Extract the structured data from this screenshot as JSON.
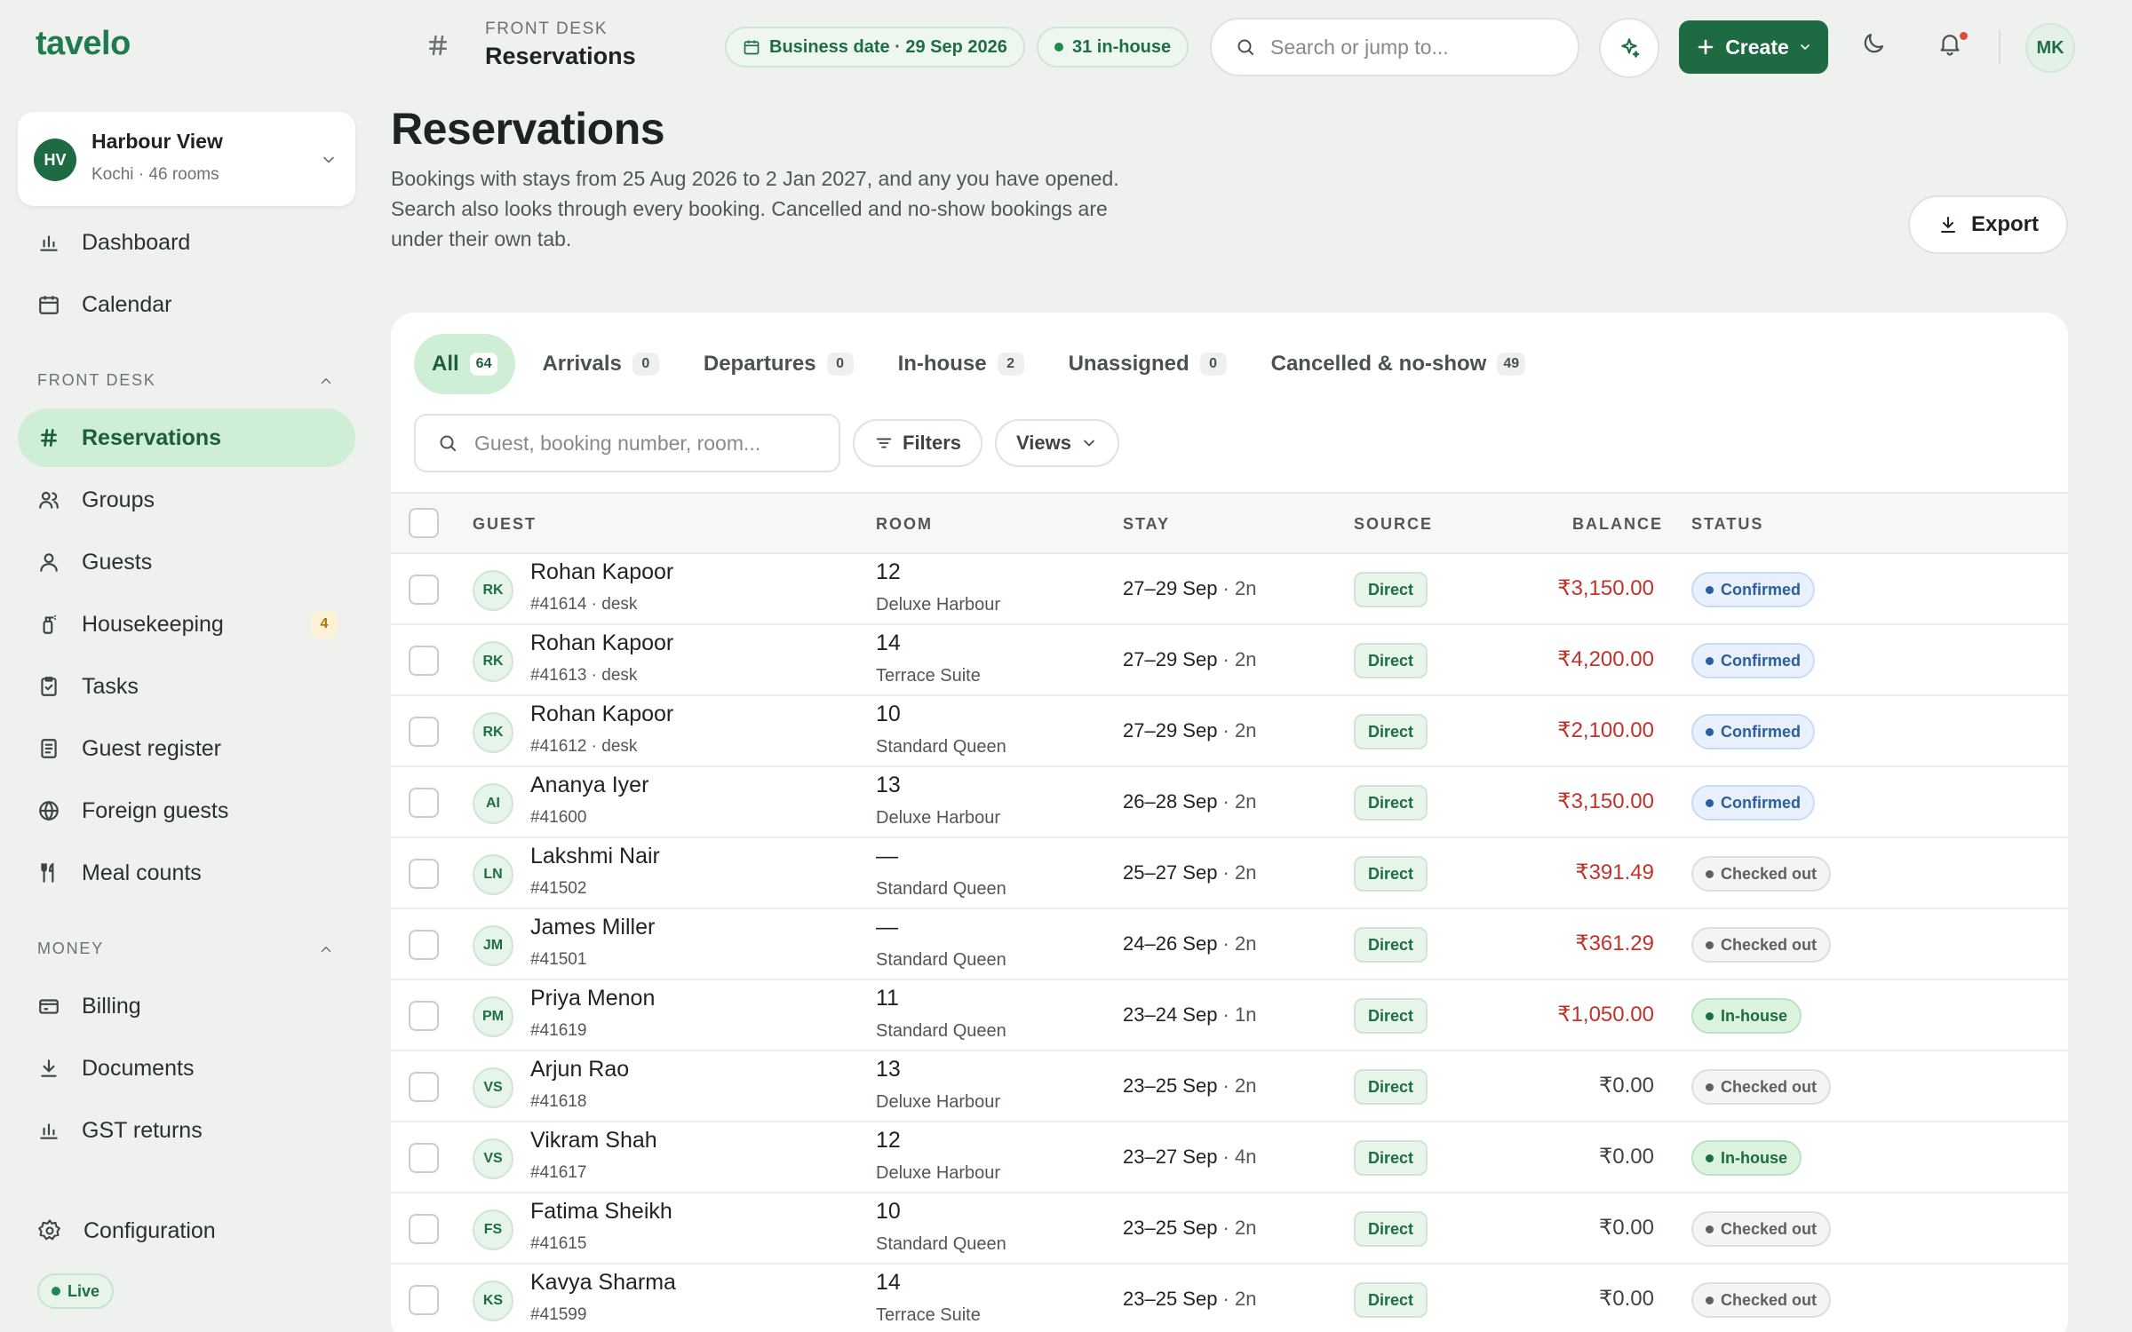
{
  "app": {
    "logo": "tavelo"
  },
  "header": {
    "crumb_section": "FRONT DESK",
    "crumb_title": "Reservations",
    "business_date": "Business date · 29 Sep 2026",
    "in_house": "31 in-house",
    "search_placeholder": "Search or jump to...",
    "create_label": "Create",
    "user_initials": "MK"
  },
  "property": {
    "initials": "HV",
    "name": "Harbour View",
    "sub": "Kochi · 46 rooms"
  },
  "sidebar": {
    "top_items": [
      {
        "label": "Dashboard",
        "icon": "bar-chart-icon"
      },
      {
        "label": "Calendar",
        "icon": "calendar-icon"
      }
    ],
    "front_desk_label": "FRONT DESK",
    "front_desk_items": [
      {
        "label": "Reservations",
        "icon": "hash-icon"
      },
      {
        "label": "Groups",
        "icon": "users-icon"
      },
      {
        "label": "Guests",
        "icon": "user-icon"
      },
      {
        "label": "Housekeeping",
        "icon": "spray-icon",
        "badge": "4"
      },
      {
        "label": "Tasks",
        "icon": "clipboard-check-icon"
      },
      {
        "label": "Guest register",
        "icon": "register-icon"
      },
      {
        "label": "Foreign guests",
        "icon": "globe-icon"
      },
      {
        "label": "Meal counts",
        "icon": "utensils-icon"
      }
    ],
    "money_label": "MONEY",
    "money_items": [
      {
        "label": "Billing",
        "icon": "credit-card-icon"
      },
      {
        "label": "Documents",
        "icon": "download-icon"
      },
      {
        "label": "GST returns",
        "icon": "bar-chart-icon"
      }
    ],
    "config_label": "Configuration",
    "live_label": "Live"
  },
  "main": {
    "title": "Reservations",
    "description": "Bookings with stays from 25 Aug 2026 to 2 Jan 2027, and any you have opened. Search also looks through every booking. Cancelled and no-show bookings are under their own tab.",
    "export_label": "Export",
    "tabs": [
      {
        "label": "All",
        "count": "64"
      },
      {
        "label": "Arrivals",
        "count": "0"
      },
      {
        "label": "Departures",
        "count": "0"
      },
      {
        "label": "In-house",
        "count": "2"
      },
      {
        "label": "Unassigned",
        "count": "0"
      },
      {
        "label": "Cancelled & no-show",
        "count": "49"
      }
    ],
    "search_placeholder": "Guest, booking number, room...",
    "filters_label": "Filters",
    "views_label": "Views",
    "columns": [
      "GUEST",
      "ROOM",
      "STAY",
      "SOURCE",
      "BALANCE",
      "STATUS"
    ],
    "rows": [
      {
        "initials": "RK",
        "name": "Rohan Kapoor",
        "ref": "#41614 · desk",
        "room": "12",
        "room_type": "Deluxe Harbour",
        "stay": "27–29 Sep",
        "nights": "2n",
        "source": "Direct",
        "balance": "₹3,150.00",
        "balance_due": true,
        "status": "Confirmed",
        "status_kind": "confirmed"
      },
      {
        "initials": "RK",
        "name": "Rohan Kapoor",
        "ref": "#41613 · desk",
        "room": "14",
        "room_type": "Terrace Suite",
        "stay": "27–29 Sep",
        "nights": "2n",
        "source": "Direct",
        "balance": "₹4,200.00",
        "balance_due": true,
        "status": "Confirmed",
        "status_kind": "confirmed"
      },
      {
        "initials": "RK",
        "name": "Rohan Kapoor",
        "ref": "#41612 · desk",
        "room": "10",
        "room_type": "Standard Queen",
        "stay": "27–29 Sep",
        "nights": "2n",
        "source": "Direct",
        "balance": "₹2,100.00",
        "balance_due": true,
        "status": "Confirmed",
        "status_kind": "confirmed"
      },
      {
        "initials": "AI",
        "name": "Ananya Iyer",
        "ref": "#41600",
        "room": "13",
        "room_type": "Deluxe Harbour",
        "stay": "26–28 Sep",
        "nights": "2n",
        "source": "Direct",
        "balance": "₹3,150.00",
        "balance_due": true,
        "status": "Confirmed",
        "status_kind": "confirmed"
      },
      {
        "initials": "LN",
        "name": "Lakshmi Nair",
        "ref": "#41502",
        "room": "—",
        "room_type": "Standard Queen",
        "stay": "25–27 Sep",
        "nights": "2n",
        "source": "Direct",
        "balance": "₹391.49",
        "balance_due": true,
        "status": "Checked out",
        "status_kind": "checkedout"
      },
      {
        "initials": "JM",
        "name": "James Miller",
        "ref": "#41501",
        "room": "—",
        "room_type": "Standard Queen",
        "stay": "24–26 Sep",
        "nights": "2n",
        "source": "Direct",
        "balance": "₹361.29",
        "balance_due": true,
        "status": "Checked out",
        "status_kind": "checkedout"
      },
      {
        "initials": "PM",
        "name": "Priya Menon",
        "ref": "#41619",
        "room": "11",
        "room_type": "Standard Queen",
        "stay": "23–24 Sep",
        "nights": "1n",
        "source": "Direct",
        "balance": "₹1,050.00",
        "balance_due": true,
        "status": "In-house",
        "status_kind": "inhouse"
      },
      {
        "initials": "VS",
        "name": "Arjun Rao",
        "ref": "#41618",
        "room": "13",
        "room_type": "Deluxe Harbour",
        "stay": "23–25 Sep",
        "nights": "2n",
        "source": "Direct",
        "balance": "₹0.00",
        "balance_due": false,
        "status": "Checked out",
        "status_kind": "checkedout"
      },
      {
        "initials": "VS",
        "name": "Vikram Shah",
        "ref": "#41617",
        "room": "12",
        "room_type": "Deluxe Harbour",
        "stay": "23–27 Sep",
        "nights": "4n",
        "source": "Direct",
        "balance": "₹0.00",
        "balance_due": false,
        "status": "In-house",
        "status_kind": "inhouse"
      },
      {
        "initials": "FS",
        "name": "Fatima Sheikh",
        "ref": "#41615",
        "room": "10",
        "room_type": "Standard Queen",
        "stay": "23–25 Sep",
        "nights": "2n",
        "source": "Direct",
        "balance": "₹0.00",
        "balance_due": false,
        "status": "Checked out",
        "status_kind": "checkedout"
      },
      {
        "initials": "KS",
        "name": "Kavya Sharma",
        "ref": "#41599",
        "room": "14",
        "room_type": "Terrace Suite",
        "stay": "23–25 Sep",
        "nights": "2n",
        "source": "Direct",
        "balance": "₹0.00",
        "balance_due": false,
        "status": "Checked out",
        "status_kind": "checkedout"
      }
    ]
  }
}
